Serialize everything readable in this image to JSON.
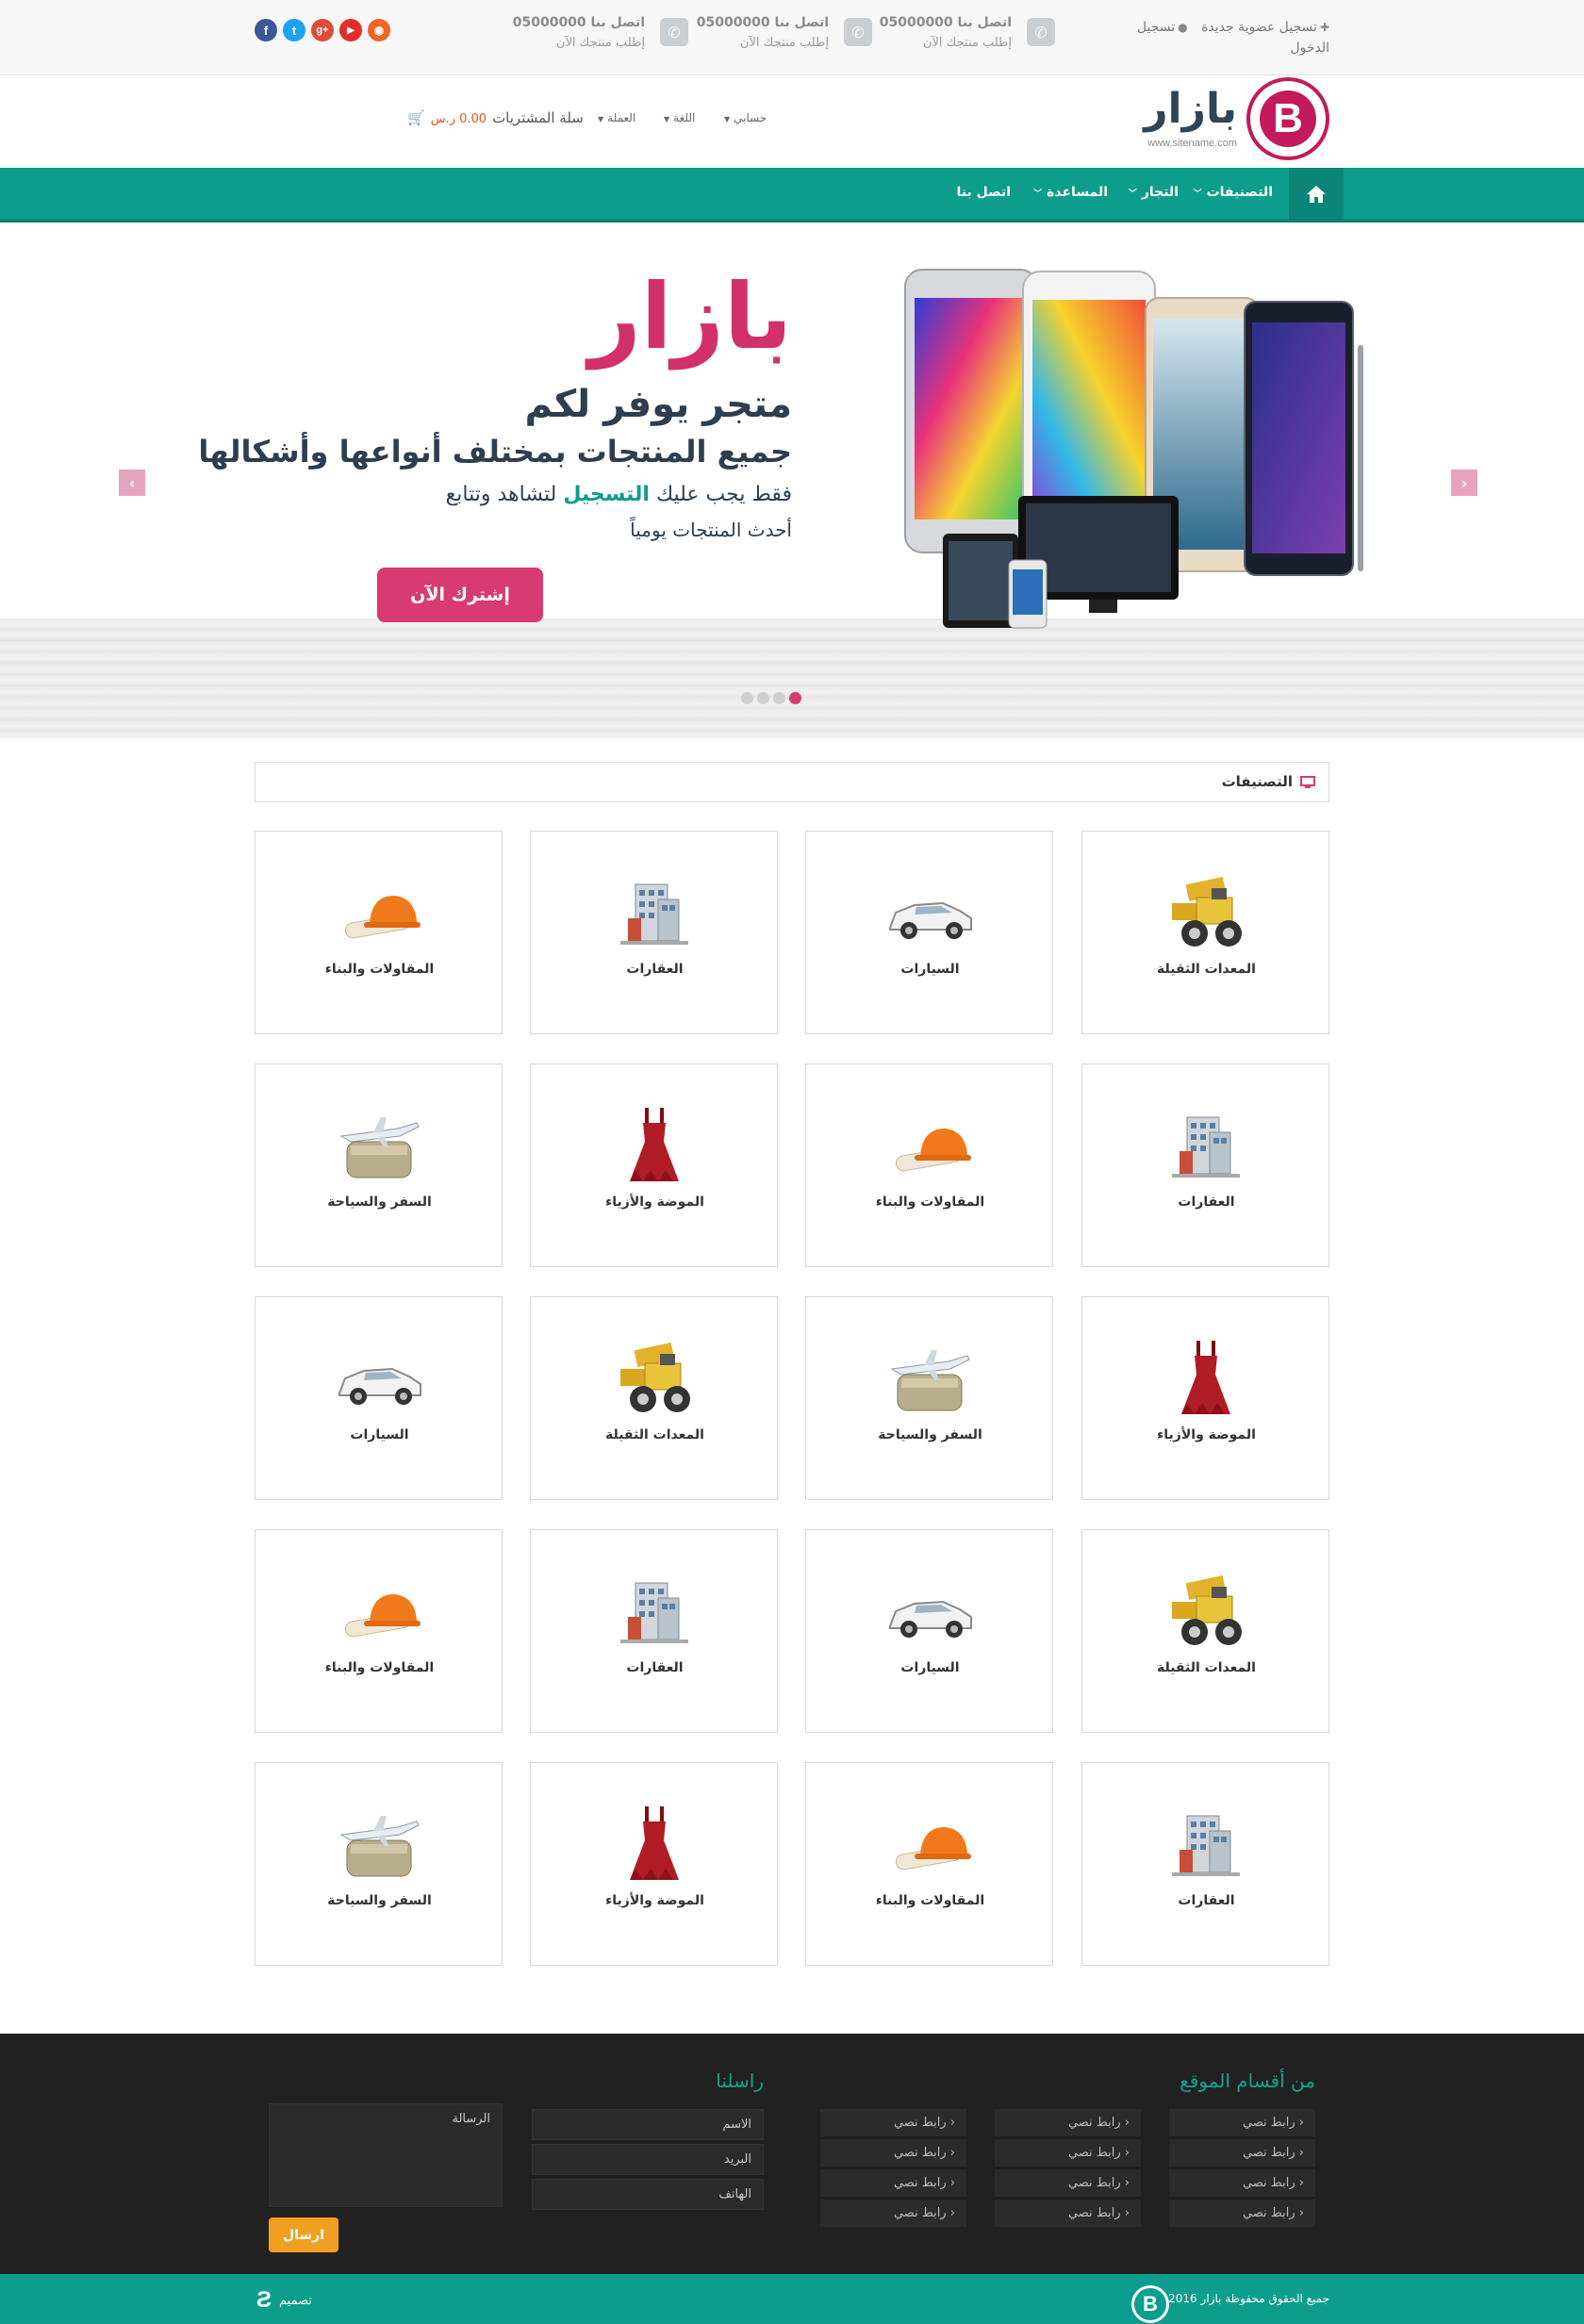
{
  "topbar": {
    "social": [
      {
        "name": "facebook-icon",
        "glyph": "f",
        "color": "#3b5998"
      },
      {
        "name": "twitter-icon",
        "glyph": "t",
        "color": "#1da1f2"
      },
      {
        "name": "google-plus-icon",
        "glyph": "g+",
        "color": "#dd4b39"
      },
      {
        "name": "youtube-icon",
        "glyph": "▶",
        "color": "#e52d27"
      },
      {
        "name": "rss-icon",
        "glyph": "◉",
        "color": "#f26522"
      }
    ],
    "contacts": [
      {
        "title": "اتصل بنا 05000000",
        "sub": "إطلب منتجك الآن"
      },
      {
        "title": "اتصل بنا 05000000",
        "sub": "إطلب منتجك الآن"
      },
      {
        "title": "اتصل بنا 05000000",
        "sub": "إطلب منتجك الآن"
      }
    ],
    "register_label": "تسجيل عضوية جديدة",
    "login_label": "تسجيل الدخول"
  },
  "header": {
    "logo_name": "بازار",
    "logo_url": "www.sitename.com",
    "logo_letter": "B",
    "menus": {
      "account": "حسابي",
      "language": "اللغة",
      "currency": "العملة"
    },
    "cart_label": "سلة المشتريات",
    "cart_amount": "0.00 ر.س"
  },
  "nav": {
    "items": [
      {
        "label": "التصنيفات",
        "dropdown": true
      },
      {
        "label": "التجار",
        "dropdown": true
      },
      {
        "label": "المساعدة",
        "dropdown": true
      },
      {
        "label": "اتصل بنا",
        "dropdown": false
      }
    ]
  },
  "slider": {
    "brand": "بازار",
    "line1": "متجر يوفر لكم",
    "line2": "جميع المنتجات بمختلف أنواعها وأشكالها",
    "line3_before": "فقط يجب عليك",
    "line3_highlight": "التسجيل",
    "line3_after": "لتشاهد وتتابع",
    "line4": "أحدث المنتجات يومياً",
    "button": "إشترك الآن",
    "dots": 4,
    "active_dot": 3
  },
  "categories": {
    "title": "التصنيفات",
    "items": [
      {
        "label": "المعدات الثقيلة",
        "icon": "bulldozer"
      },
      {
        "label": "السيارات",
        "icon": "car"
      },
      {
        "label": "العقارات",
        "icon": "building"
      },
      {
        "label": "المقاولات والبناء",
        "icon": "helmet"
      },
      {
        "label": "العقارات",
        "icon": "building"
      },
      {
        "label": "المقاولات والبناء",
        "icon": "helmet"
      },
      {
        "label": "الموضة والأزياء",
        "icon": "dress"
      },
      {
        "label": "السفر والسياحة",
        "icon": "travel"
      },
      {
        "label": "الموضة والأزياء",
        "icon": "dress"
      },
      {
        "label": "السفر والسياحة",
        "icon": "travel"
      },
      {
        "label": "المعدات الثقيلة",
        "icon": "bulldozer"
      },
      {
        "label": "السيارات",
        "icon": "car"
      },
      {
        "label": "المعدات الثقيلة",
        "icon": "bulldozer"
      },
      {
        "label": "السيارات",
        "icon": "car"
      },
      {
        "label": "العقارات",
        "icon": "building"
      },
      {
        "label": "المقاولات والبناء",
        "icon": "helmet"
      },
      {
        "label": "العقارات",
        "icon": "building"
      },
      {
        "label": "المقاولات والبناء",
        "icon": "helmet"
      },
      {
        "label": "الموضة والأزياء",
        "icon": "dress"
      },
      {
        "label": "السفر والسياحة",
        "icon": "travel"
      }
    ]
  },
  "footer": {
    "sections_title": "من أقسام الموقع",
    "contact_title": "راسلنا",
    "link_text": "رابط نصي",
    "name_placeholder": "الاسم",
    "email_placeholder": "البريد",
    "phone_placeholder": "الهاتف",
    "message_placeholder": "الرسالة",
    "send_button": "ارسال"
  },
  "bottombar": {
    "copyright": "جميع الحقوق محفوظة  بازار 2016",
    "design_label": "تصميم",
    "logo_letter": "B"
  },
  "colors": {
    "brand": "#0d9d8c",
    "accent": "#d83b71",
    "logo": "#c21a5a",
    "footer_bg": "#212121",
    "send_button": "#f0a021"
  }
}
